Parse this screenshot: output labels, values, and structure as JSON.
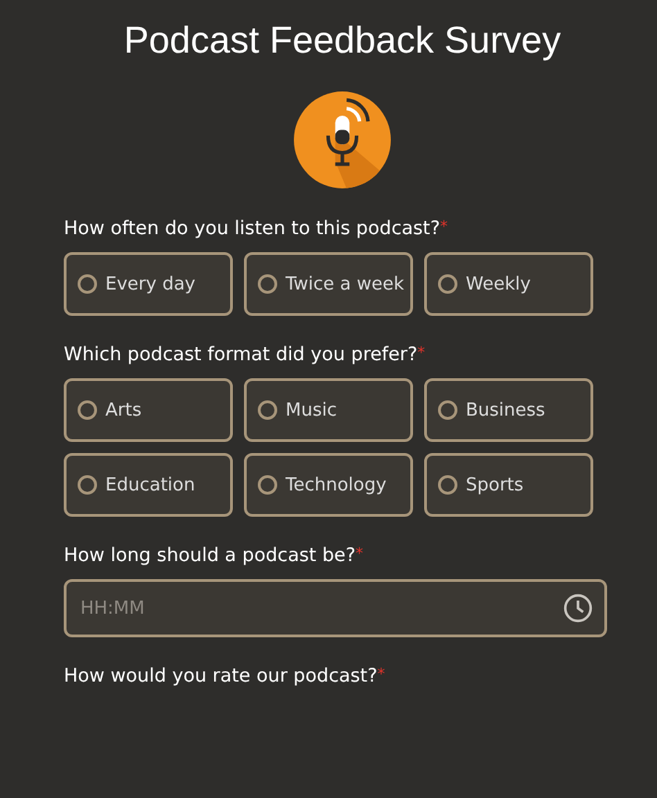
{
  "title": "Podcast Feedback Survey",
  "questions": [
    {
      "kind": "choice",
      "label": "How often do you listen to this podcast?",
      "required_mark": "*",
      "options": [
        {
          "label": "Every day",
          "selected": false
        },
        {
          "label": "Twice a week",
          "selected": false
        },
        {
          "label": "Weekly",
          "selected": false
        }
      ]
    },
    {
      "kind": "choice",
      "label": "Which podcast format did you prefer?",
      "required_mark": "*",
      "options": [
        {
          "label": "Arts",
          "selected": false
        },
        {
          "label": "Music",
          "selected": false
        },
        {
          "label": "Business",
          "selected": false
        },
        {
          "label": "Education",
          "selected": false
        },
        {
          "label": "Technology",
          "selected": false
        },
        {
          "label": "Sports",
          "selected": false
        }
      ]
    },
    {
      "kind": "time",
      "label": "How long should a podcast be?",
      "required_mark": "*",
      "placeholder": "HH:MM"
    },
    {
      "kind": "rating",
      "label": "How would you rate our podcast?",
      "required_mark": "*"
    }
  ]
}
